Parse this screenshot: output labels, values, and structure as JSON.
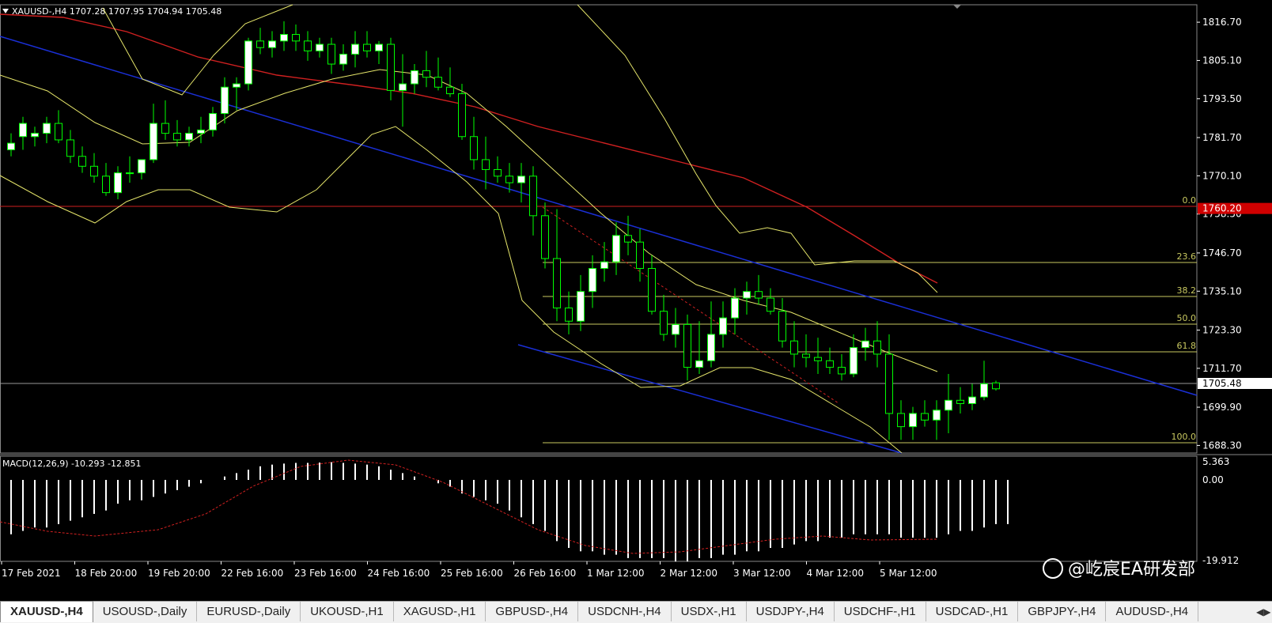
{
  "header": {
    "symbol_info": "XAUUSD-,H4",
    "ohlc": "1707.28 1707.95 1704.94 1705.48"
  },
  "macd": {
    "label": "MACD(12,26,9) -10.293 -12.851",
    "axis_top": "5.363",
    "axis_zero": "0.00",
    "axis_bottom": "-19.912"
  },
  "price_axis": [
    "1816.70",
    "1805.10",
    "1793.50",
    "1781.70",
    "1770.10",
    "1758.50",
    "1746.70",
    "1735.10",
    "1723.30",
    "1711.70",
    "1699.90",
    "1688.30"
  ],
  "markers": {
    "red_level": "1760.20",
    "current": "1705.48"
  },
  "fibo": [
    "0.0",
    "23.6",
    "38.2",
    "50.0",
    "61.8",
    "100.0"
  ],
  "time_axis": [
    "17 Feb 2021",
    "18 Feb 20:00",
    "19 Feb 20:00",
    "22 Feb 16:00",
    "23 Feb 16:00",
    "24 Feb 16:00",
    "25 Feb 16:00",
    "26 Feb 16:00",
    "1 Mar 12:00",
    "2 Mar 12:00",
    "3 Mar 12:00",
    "4 Mar 12:00",
    "5 Mar 12:00"
  ],
  "watermark": "@屹宸EA研发部",
  "tabs": [
    "XAUUSD-,H4",
    "USOUSD-,Daily",
    "EURUSD-,Daily",
    "UKOUSD-,H1",
    "XAGUSD-,H1",
    "GBPUSD-,H4",
    "USDCNH-,H4",
    "USDX-,H1",
    "USDJPY-,H4",
    "USDCHF-,H1",
    "USDCAD-,H1",
    "GBPJPY-,H4",
    "AUDUSD-,H4"
  ],
  "colors": {
    "bull": "#ffffff",
    "bear": "#000000",
    "wick": "#00ff00",
    "bands": "#e5e56a",
    "ma": "#d02020",
    "channel": "#1a2fd6",
    "fibo": "#c8c860",
    "axis": "#ffffff"
  },
  "chart_data": {
    "type": "candlestick",
    "symbol": "XAUUSD-",
    "timeframe": "H4",
    "ylim": [
      1686,
      1822
    ],
    "candles": [
      [
        1778,
        1783,
        1776,
        1780
      ],
      [
        1782,
        1788,
        1778,
        1786
      ],
      [
        1782,
        1785,
        1779,
        1783
      ],
      [
        1783,
        1788,
        1780,
        1786
      ],
      [
        1786,
        1790,
        1780,
        1781
      ],
      [
        1781,
        1784,
        1774,
        1776
      ],
      [
        1776,
        1779,
        1771,
        1773
      ],
      [
        1773,
        1777,
        1768,
        1770
      ],
      [
        1770,
        1774,
        1764,
        1765
      ],
      [
        1765,
        1773,
        1763,
        1771
      ],
      [
        1771,
        1776,
        1768,
        1771
      ],
      [
        1771,
        1775,
        1769,
        1775
      ],
      [
        1775,
        1792,
        1774,
        1786
      ],
      [
        1786,
        1793,
        1781,
        1783
      ],
      [
        1783,
        1787,
        1779,
        1781
      ],
      [
        1781,
        1785,
        1779,
        1783
      ],
      [
        1783,
        1788,
        1780,
        1784
      ],
      [
        1784,
        1791,
        1782,
        1789
      ],
      [
        1789,
        1800,
        1786,
        1797
      ],
      [
        1797,
        1800,
        1790,
        1798
      ],
      [
        1798,
        1812,
        1796,
        1811
      ],
      [
        1811,
        1815,
        1807,
        1809
      ],
      [
        1809,
        1814,
        1806,
        1811
      ],
      [
        1811,
        1817,
        1808,
        1813
      ],
      [
        1813,
        1816,
        1808,
        1811
      ],
      [
        1811,
        1814,
        1805,
        1808
      ],
      [
        1808,
        1812,
        1806,
        1810
      ],
      [
        1810,
        1812,
        1801,
        1804
      ],
      [
        1804,
        1810,
        1802,
        1807
      ],
      [
        1807,
        1814,
        1803,
        1810
      ],
      [
        1810,
        1814,
        1806,
        1808
      ],
      [
        1808,
        1811,
        1804,
        1810
      ],
      [
        1810,
        1812,
        1793,
        1796
      ],
      [
        1796,
        1807,
        1785,
        1798
      ],
      [
        1798,
        1804,
        1795,
        1802
      ],
      [
        1802,
        1808,
        1797,
        1800
      ],
      [
        1800,
        1806,
        1796,
        1797
      ],
      [
        1797,
        1803,
        1794,
        1795
      ],
      [
        1795,
        1798,
        1781,
        1782
      ],
      [
        1782,
        1788,
        1772,
        1775
      ],
      [
        1775,
        1782,
        1766,
        1772
      ],
      [
        1772,
        1776,
        1768,
        1770
      ],
      [
        1770,
        1774,
        1765,
        1768
      ],
      [
        1768,
        1774,
        1762,
        1770
      ],
      [
        1770,
        1773,
        1752,
        1758
      ],
      [
        1758,
        1762,
        1742,
        1745
      ],
      [
        1745,
        1760,
        1726,
        1730
      ],
      [
        1730,
        1735,
        1722,
        1726
      ],
      [
        1726,
        1740,
        1723,
        1735
      ],
      [
        1735,
        1746,
        1730,
        1742
      ],
      [
        1742,
        1750,
        1738,
        1744
      ],
      [
        1744,
        1756,
        1740,
        1752
      ],
      [
        1752,
        1758,
        1746,
        1750
      ],
      [
        1750,
        1754,
        1738,
        1742
      ],
      [
        1742,
        1746,
        1728,
        1729
      ],
      [
        1729,
        1734,
        1720,
        1722
      ],
      [
        1722,
        1730,
        1718,
        1725
      ],
      [
        1725,
        1728,
        1708,
        1712
      ],
      [
        1712,
        1726,
        1710,
        1714
      ],
      [
        1714,
        1732,
        1712,
        1722
      ],
      [
        1722,
        1732,
        1718,
        1727
      ],
      [
        1727,
        1736,
        1722,
        1733
      ],
      [
        1733,
        1738,
        1728,
        1735
      ],
      [
        1735,
        1740,
        1731,
        1733
      ],
      [
        1733,
        1736,
        1728,
        1729
      ],
      [
        1729,
        1733,
        1718,
        1720
      ],
      [
        1720,
        1726,
        1712,
        1716
      ],
      [
        1716,
        1722,
        1712,
        1715
      ],
      [
        1715,
        1721,
        1710,
        1714
      ],
      [
        1714,
        1718,
        1710,
        1712
      ],
      [
        1712,
        1716,
        1708,
        1710
      ],
      [
        1710,
        1722,
        1709,
        1718
      ],
      [
        1718,
        1724,
        1714,
        1720
      ],
      [
        1720,
        1726,
        1712,
        1716
      ],
      [
        1716,
        1722,
        1690,
        1698
      ],
      [
        1698,
        1702,
        1690,
        1694
      ],
      [
        1694,
        1700,
        1690,
        1698
      ],
      [
        1698,
        1702,
        1694,
        1696
      ],
      [
        1696,
        1702,
        1690,
        1699
      ],
      [
        1699,
        1710,
        1692,
        1702
      ],
      [
        1702,
        1706,
        1698,
        1701
      ],
      [
        1701,
        1707,
        1699,
        1703
      ],
      [
        1703,
        1714,
        1702,
        1707
      ],
      [
        1707.28,
        1707.95,
        1704.94,
        1705.48
      ]
    ]
  }
}
